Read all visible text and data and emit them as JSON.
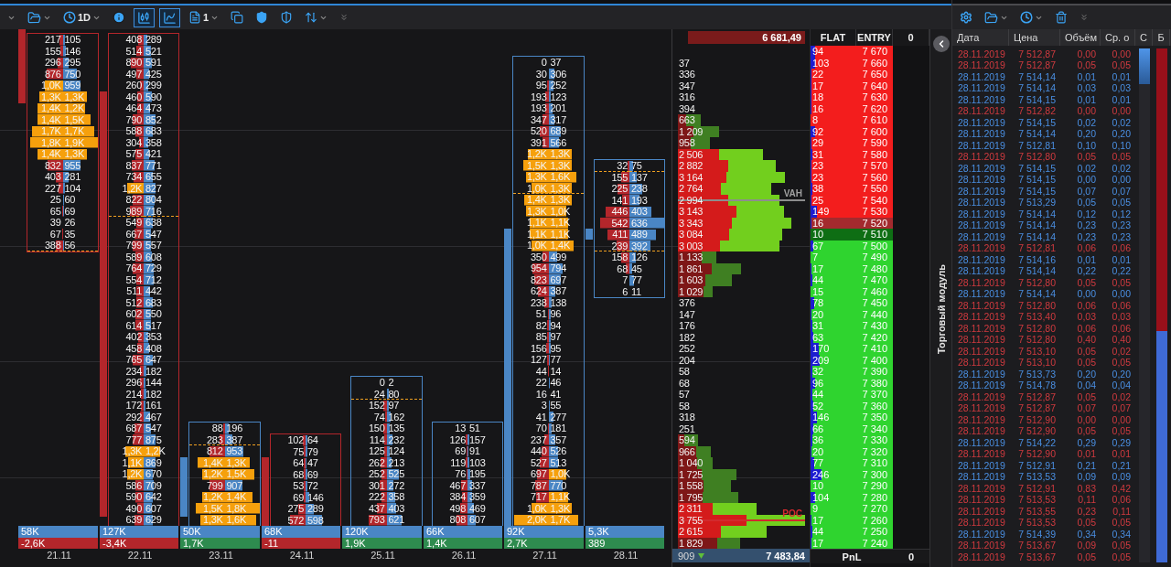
{
  "toolbar": {
    "timeframe": "1D",
    "layout_count": "1",
    "view_toggles": [
      {
        "selected": true
      },
      {
        "selected": true
      }
    ]
  },
  "columns": [
    {
      "date": "21.11",
      "kind": "down",
      "volume": "58K",
      "delta": "-2,6K",
      "blocks": [
        {
          "dashed": true,
          "rows": [
            {
              "bid": "217",
              "ask": "105"
            },
            {
              "bid": "155",
              "ask": "146"
            },
            {
              "bid": "296",
              "ask": "295"
            },
            {
              "bid": "876",
              "ask": "750"
            },
            {
              "bid": "1,0K",
              "ask": "959"
            },
            {
              "bid": "1,3K",
              "ask": "1,3K"
            },
            {
              "bid": "1,4K",
              "ask": "1,2K"
            },
            {
              "bid": "1,4K",
              "ask": "1,5K"
            },
            {
              "bid": "1,7K",
              "ask": "1,7K"
            },
            {
              "bid": "1,8K",
              "ask": "1,9K"
            },
            {
              "bid": "1,4K",
              "ask": "1,3K"
            },
            {
              "bid": "832",
              "ask": "955"
            },
            {
              "bid": "403",
              "ask": "281"
            },
            {
              "bid": "227",
              "ask": "104"
            },
            {
              "bid": "25",
              "ask": "60"
            },
            {
              "bid": "65",
              "ask": "69"
            },
            {
              "bid": "39",
              "ask": "26"
            },
            {
              "bid": "67",
              "ask": "35"
            },
            {
              "bid": "388",
              "ask": "56"
            }
          ]
        }
      ]
    },
    {
      "date": "22.11",
      "kind": "down",
      "volume": "127K",
      "delta": "-3,4K",
      "blocks": [
        {
          "dashed": true,
          "rows": [
            {
              "bid": "408",
              "ask": "289"
            },
            {
              "bid": "514",
              "ask": "521"
            },
            {
              "bid": "890",
              "ask": "591"
            },
            {
              "bid": "497",
              "ask": "425"
            },
            {
              "bid": "260",
              "ask": "299"
            },
            {
              "bid": "460",
              "ask": "590"
            },
            {
              "bid": "464",
              "ask": "473"
            },
            {
              "bid": "790",
              "ask": "852"
            },
            {
              "bid": "588",
              "ask": "683"
            },
            {
              "bid": "304",
              "ask": "358"
            },
            {
              "bid": "575",
              "ask": "421"
            },
            {
              "bid": "837",
              "ask": "771"
            },
            {
              "bid": "734",
              "ask": "655"
            },
            {
              "bid": "1,2K",
              "ask": "827"
            },
            {
              "bid": "822",
              "ask": "804"
            },
            {
              "bid": "989",
              "ask": "716"
            }
          ]
        },
        {
          "dashed": false,
          "rows": [
            {
              "bid": "549",
              "ask": "638"
            },
            {
              "bid": "667",
              "ask": "547"
            },
            {
              "bid": "799",
              "ask": "557"
            },
            {
              "bid": "589",
              "ask": "608"
            },
            {
              "bid": "764",
              "ask": "729"
            },
            {
              "bid": "554",
              "ask": "712"
            },
            {
              "bid": "511",
              "ask": "442"
            },
            {
              "bid": "512",
              "ask": "683"
            },
            {
              "bid": "602",
              "ask": "550"
            },
            {
              "bid": "614",
              "ask": "517"
            },
            {
              "bid": "402",
              "ask": "353"
            },
            {
              "bid": "458",
              "ask": "408"
            },
            {
              "bid": "765",
              "ask": "647"
            },
            {
              "bid": "234",
              "ask": "182"
            },
            {
              "bid": "296",
              "ask": "144"
            },
            {
              "bid": "214",
              "ask": "182"
            },
            {
              "bid": "172",
              "ask": "161"
            },
            {
              "bid": "292",
              "ask": "467"
            },
            {
              "bid": "687",
              "ask": "547"
            },
            {
              "bid": "777",
              "ask": "875"
            },
            {
              "bid": "1,3K",
              "ask": "1,2K"
            },
            {
              "bid": "1,1K",
              "ask": "869"
            },
            {
              "bid": "1,2K",
              "ask": "670"
            },
            {
              "bid": "586",
              "ask": "709"
            },
            {
              "bid": "590",
              "ask": "642"
            },
            {
              "bid": "490",
              "ask": "607"
            },
            {
              "bid": "639",
              "ask": "629"
            }
          ]
        }
      ]
    },
    {
      "date": "23.11",
      "kind": "up",
      "volume": "50K",
      "delta": "1,7K",
      "blocks": [
        {
          "dashed": true,
          "rows": [
            {
              "bid": "88",
              "ask": "196"
            },
            {
              "bid": "283",
              "ask": "387"
            }
          ]
        },
        {
          "dashed": false,
          "rows": [
            {
              "bid": "812",
              "ask": "953"
            },
            {
              "bid": "1,4K",
              "ask": "1,3K"
            },
            {
              "bid": "1,2K",
              "ask": "1,5K"
            },
            {
              "bid": "799",
              "ask": "907"
            },
            {
              "bid": "1,2K",
              "ask": "1,4K"
            },
            {
              "bid": "1,5K",
              "ask": "1,8K"
            },
            {
              "bid": "1,3K",
              "ask": "1,6K"
            }
          ]
        }
      ]
    },
    {
      "date": "24.11",
      "kind": "down",
      "volume": "68K",
      "delta": "-11",
      "blocks": [
        {
          "dashed": false,
          "rows": [
            {
              "bid": "102",
              "ask": "64"
            },
            {
              "bid": "75",
              "ask": "79"
            },
            {
              "bid": "64",
              "ask": "47"
            },
            {
              "bid": "68",
              "ask": "69"
            },
            {
              "bid": "53",
              "ask": "72"
            },
            {
              "bid": "69",
              "ask": "146"
            },
            {
              "bid": "275",
              "ask": "289"
            },
            {
              "bid": "572",
              "ask": "598"
            }
          ]
        }
      ]
    },
    {
      "date": "25.11",
      "kind": "up",
      "volume": "120K",
      "delta": "1,9K",
      "blocks": [
        {
          "dashed": true,
          "rows": [
            {
              "bid": "0",
              "ask": "2"
            },
            {
              "bid": "24",
              "ask": "80"
            }
          ]
        },
        {
          "dashed": false,
          "rows": [
            {
              "bid": "152",
              "ask": "97"
            },
            {
              "bid": "74",
              "ask": "162"
            },
            {
              "bid": "150",
              "ask": "135"
            },
            {
              "bid": "114",
              "ask": "232"
            },
            {
              "bid": "125",
              "ask": "124"
            },
            {
              "bid": "262",
              "ask": "213"
            },
            {
              "bid": "252",
              "ask": "525"
            },
            {
              "bid": "301",
              "ask": "272"
            },
            {
              "bid": "222",
              "ask": "358"
            },
            {
              "bid": "437",
              "ask": "403"
            },
            {
              "bid": "793",
              "ask": "621"
            }
          ]
        }
      ]
    },
    {
      "date": "26.11",
      "kind": "up",
      "volume": "66K",
      "delta": "1,4K",
      "blocks": [
        {
          "dashed": false,
          "rows": [
            {
              "bid": "13",
              "ask": "51"
            },
            {
              "bid": "126",
              "ask": "157"
            },
            {
              "bid": "69",
              "ask": "91"
            },
            {
              "bid": "119",
              "ask": "103"
            },
            {
              "bid": "76",
              "ask": "195"
            },
            {
              "bid": "467",
              "ask": "337"
            },
            {
              "bid": "384",
              "ask": "359"
            },
            {
              "bid": "498",
              "ask": "469"
            },
            {
              "bid": "808",
              "ask": "607"
            }
          ]
        }
      ]
    },
    {
      "date": "27.11",
      "kind": "up",
      "volume": "92K",
      "delta": "2,7K",
      "blocks": [
        {
          "dashed": true,
          "rows": [
            {
              "bid": "0",
              "ask": "37"
            },
            {
              "bid": "30",
              "ask": "306"
            },
            {
              "bid": "95",
              "ask": "252"
            },
            {
              "bid": "193",
              "ask": "123"
            },
            {
              "bid": "193",
              "ask": "201"
            },
            {
              "bid": "347",
              "ask": "317"
            },
            {
              "bid": "520",
              "ask": "689"
            },
            {
              "bid": "391",
              "ask": "566"
            },
            {
              "bid": "1,2K",
              "ask": "1,3K"
            },
            {
              "bid": "1,5K",
              "ask": "1,3K"
            },
            {
              "bid": "1,3K",
              "ask": "1,6K"
            },
            {
              "bid": "1,0K",
              "ask": "1,3K"
            }
          ]
        },
        {
          "dashed": false,
          "rows": [
            {
              "bid": "1,4K",
              "ask": "1,3K"
            },
            {
              "bid": "1,3K",
              "ask": "1,0K"
            },
            {
              "bid": "1,1K",
              "ask": "1,1K"
            },
            {
              "bid": "1,1K",
              "ask": "1,1K"
            },
            {
              "bid": "1,0K",
              "ask": "1,4K"
            },
            {
              "bid": "350",
              "ask": "499"
            },
            {
              "bid": "954",
              "ask": "794"
            },
            {
              "bid": "823",
              "ask": "697"
            },
            {
              "bid": "624",
              "ask": "387"
            },
            {
              "bid": "238",
              "ask": "138"
            },
            {
              "bid": "51",
              "ask": "96"
            },
            {
              "bid": "82",
              "ask": "94"
            },
            {
              "bid": "85",
              "ask": "97"
            },
            {
              "bid": "156",
              "ask": "95"
            },
            {
              "bid": "127",
              "ask": "77"
            },
            {
              "bid": "44",
              "ask": "14"
            },
            {
              "bid": "22",
              "ask": "46"
            },
            {
              "bid": "16",
              "ask": "41"
            },
            {
              "bid": "3",
              "ask": "55"
            },
            {
              "bid": "41",
              "ask": "277"
            },
            {
              "bid": "70",
              "ask": "181"
            },
            {
              "bid": "237",
              "ask": "357"
            },
            {
              "bid": "440",
              "ask": "526"
            },
            {
              "bid": "527",
              "ask": "513"
            },
            {
              "bid": "697",
              "ask": "1,0K"
            },
            {
              "bid": "787",
              "ask": "770"
            },
            {
              "bid": "717",
              "ask": "1,1K"
            },
            {
              "bid": "1,0K",
              "ask": "1,3K"
            },
            {
              "bid": "2,0K",
              "ask": "1,7K"
            }
          ]
        }
      ]
    },
    {
      "date": "28.11",
      "kind": "up",
      "volume": "5,3K",
      "delta": "389",
      "blocks": [
        {
          "dashed": true,
          "rows": [
            {
              "bid": "32",
              "ask": "75"
            }
          ]
        },
        {
          "dashed": true,
          "rows": [
            {
              "bid": "155",
              "ask": "137"
            },
            {
              "bid": "225",
              "ask": "238"
            },
            {
              "bid": "141",
              "ask": "193"
            },
            {
              "bid": "446",
              "ask": "403"
            },
            {
              "bid": "542",
              "ask": "636"
            },
            {
              "bid": "411",
              "ask": "489"
            },
            {
              "bid": "239",
              "ask": "392"
            }
          ]
        },
        {
          "dashed": false,
          "rows": [
            {
              "bid": "158",
              "ask": "126"
            },
            {
              "bid": "68",
              "ask": "45"
            },
            {
              "bid": "7",
              "ask": "77"
            },
            {
              "bid": "6",
              "ask": "11"
            }
          ]
        }
      ]
    }
  ],
  "profile": {
    "total": "6 681,49",
    "rows": [
      {
        "volume": "37"
      },
      {
        "volume": "336"
      },
      {
        "volume": "347"
      },
      {
        "volume": "316"
      },
      {
        "volume": "394"
      },
      {
        "volume": "663",
        "level": 0.38
      },
      {
        "volume": "1 209",
        "level": 0.38
      },
      {
        "volume": "958",
        "level": 0.4
      },
      {
        "volume": "2 506",
        "level": 0.48
      },
      {
        "volume": "2 882",
        "level": 0.52
      },
      {
        "volume": "3 164",
        "level": 0.45
      },
      {
        "volume": "2 764",
        "level": 0.46
      },
      {
        "volume": "2 994",
        "level": 0.5,
        "marker": {
          "kind": "vah",
          "label": "VAH"
        }
      },
      {
        "volume": "3 143",
        "level": 0.55
      },
      {
        "volume": "3 343",
        "level": 0.48
      },
      {
        "volume": "3 084",
        "level": 0.49
      },
      {
        "volume": "3 003",
        "level": 0.41
      },
      {
        "volume": "1 133",
        "level": 0.61
      },
      {
        "volume": "1 861",
        "level": 0.54
      },
      {
        "volume": "1 603",
        "level": 0.51
      },
      {
        "volume": "1 029",
        "level": 0.74
      },
      {
        "volume": "376"
      },
      {
        "volume": "147"
      },
      {
        "volume": "176"
      },
      {
        "volume": "182"
      },
      {
        "volume": "252"
      },
      {
        "volume": "204"
      },
      {
        "volume": "58"
      },
      {
        "volume": "68"
      },
      {
        "volume": "57"
      },
      {
        "volume": "58"
      },
      {
        "volume": "318"
      },
      {
        "volume": "251"
      },
      {
        "volume": "594",
        "level": 0.33
      },
      {
        "volume": "966",
        "level": 0.56
      },
      {
        "volume": "1 040",
        "level": 0.54
      },
      {
        "volume": "1 725",
        "level": 0.41
      },
      {
        "volume": "1 558",
        "level": 0.49
      },
      {
        "volume": "1 795",
        "level": 0.4
      },
      {
        "volume": "2 311",
        "level": 0.44
      },
      {
        "volume": "3 755",
        "level": 0.54,
        "marker": {
          "kind": "poc",
          "label": "POC"
        }
      },
      {
        "volume": "2 615",
        "level": 0.49
      },
      {
        "volume": "1 829",
        "level": 0.63
      }
    ],
    "footer": {
      "count": "909",
      "price": "7 483,84"
    }
  },
  "order_book": {
    "columns": [
      "FLAT",
      "ENTRY",
      "0"
    ],
    "rows": [
      {
        "size": "94",
        "price": "7 670",
        "kind": "ask"
      },
      {
        "size": "103",
        "price": "7 660",
        "kind": "ask"
      },
      {
        "size": "22",
        "price": "7 650",
        "kind": "ask"
      },
      {
        "size": "17",
        "price": "7 640",
        "kind": "ask"
      },
      {
        "size": "18",
        "price": "7 630",
        "kind": "ask"
      },
      {
        "size": "16",
        "price": "7 620",
        "kind": "ask"
      },
      {
        "size": "8",
        "price": "7 610",
        "kind": "ask"
      },
      {
        "size": "92",
        "price": "7 600",
        "kind": "ask"
      },
      {
        "size": "29",
        "price": "7 590",
        "kind": "ask"
      },
      {
        "size": "31",
        "price": "7 580",
        "kind": "ask"
      },
      {
        "size": "23",
        "price": "7 570",
        "kind": "ask"
      },
      {
        "size": "23",
        "price": "7 560",
        "kind": "ask"
      },
      {
        "size": "38",
        "price": "7 550",
        "kind": "ask"
      },
      {
        "size": "25",
        "price": "7 540",
        "kind": "ask"
      },
      {
        "size": "149",
        "price": "7 530",
        "kind": "ask"
      },
      {
        "size": "16",
        "price": "7 520",
        "kind": "best_ask"
      },
      {
        "size": "10",
        "price": "7 510",
        "kind": "best_bid"
      },
      {
        "size": "67",
        "price": "7 500",
        "kind": "bid"
      },
      {
        "size": "7",
        "price": "7 490",
        "kind": "bid"
      },
      {
        "size": "17",
        "price": "7 480",
        "kind": "bid"
      },
      {
        "size": "44",
        "price": "7 470",
        "kind": "bid"
      },
      {
        "size": "15",
        "price": "7 460",
        "kind": "bid"
      },
      {
        "size": "78",
        "price": "7 450",
        "kind": "bid"
      },
      {
        "size": "20",
        "price": "7 440",
        "kind": "bid"
      },
      {
        "size": "31",
        "price": "7 430",
        "kind": "bid"
      },
      {
        "size": "63",
        "price": "7 420",
        "kind": "bid"
      },
      {
        "size": "170",
        "price": "7 410",
        "kind": "bid"
      },
      {
        "size": "209",
        "price": "7 400",
        "kind": "bid"
      },
      {
        "size": "32",
        "price": "7 390",
        "kind": "bid"
      },
      {
        "size": "96",
        "price": "7 380",
        "kind": "bid"
      },
      {
        "size": "44",
        "price": "7 370",
        "kind": "bid"
      },
      {
        "size": "52",
        "price": "7 360",
        "kind": "bid"
      },
      {
        "size": "146",
        "price": "7 350",
        "kind": "bid"
      },
      {
        "size": "66",
        "price": "7 340",
        "kind": "bid"
      },
      {
        "size": "36",
        "price": "7 330",
        "kind": "bid"
      },
      {
        "size": "20",
        "price": "7 320",
        "kind": "bid"
      },
      {
        "size": "77",
        "price": "7 310",
        "kind": "bid"
      },
      {
        "size": "246",
        "price": "7 300",
        "kind": "bid"
      },
      {
        "size": "10",
        "price": "7 290",
        "kind": "bid"
      },
      {
        "size": "104",
        "price": "7 280",
        "kind": "bid"
      },
      {
        "size": "9",
        "price": "7 270",
        "kind": "bid"
      },
      {
        "size": "17",
        "price": "7 260",
        "kind": "bid"
      },
      {
        "size": "44",
        "price": "7 250",
        "kind": "bid"
      },
      {
        "size": "17",
        "price": "7 240",
        "kind": "bid"
      }
    ],
    "footer": {
      "label": "PnL",
      "value": "0"
    }
  },
  "side_panel": {
    "label": "Торговый модуль"
  },
  "trades": {
    "columns": [
      "Дата",
      "Цена",
      "Объём",
      "Ср. о",
      "С",
      "Б"
    ],
    "meters": [
      {
        "level": 0.07
      },
      {
        "level": 0.55
      }
    ],
    "rows": [
      {
        "date": "28.11.2019",
        "price": "7 512,87",
        "volume": "0,00",
        "avg": "0,00",
        "color": "#d03a3f"
      },
      {
        "date": "28.11.2019",
        "price": "7 512,87",
        "volume": "0,05",
        "avg": "0,05",
        "color": "#d03a3f"
      },
      {
        "date": "28.11.2019",
        "price": "7 514,14",
        "volume": "0,01",
        "avg": "0,01",
        "color": "#4a8fe2"
      },
      {
        "date": "28.11.2019",
        "price": "7 514,14",
        "volume": "0,03",
        "avg": "0,03",
        "color": "#4a8fe2"
      },
      {
        "date": "28.11.2019",
        "price": "7 514,15",
        "volume": "0,01",
        "avg": "0,01",
        "color": "#4a8fe2"
      },
      {
        "date": "28.11.2019",
        "price": "7 512,82",
        "volume": "0,00",
        "avg": "0,00",
        "color": "#d03a3f"
      },
      {
        "date": "28.11.2019",
        "price": "7 514,15",
        "volume": "0,02",
        "avg": "0,02",
        "color": "#4a8fe2"
      },
      {
        "date": "28.11.2019",
        "price": "7 514,14",
        "volume": "0,20",
        "avg": "0,20",
        "color": "#4a8fe2"
      },
      {
        "date": "28.11.2019",
        "price": "7 512,81",
        "volume": "0,10",
        "avg": "0,10",
        "color": "#4a8fe2"
      },
      {
        "date": "28.11.2019",
        "price": "7 512,80",
        "volume": "0,05",
        "avg": "0,05",
        "color": "#d03a3f"
      },
      {
        "date": "28.11.2019",
        "price": "7 514,15",
        "volume": "0,02",
        "avg": "0,02",
        "color": "#4a8fe2"
      },
      {
        "date": "28.11.2019",
        "price": "7 514,15",
        "volume": "0,00",
        "avg": "0,00",
        "color": "#4a8fe2"
      },
      {
        "date": "28.11.2019",
        "price": "7 514,15",
        "volume": "0,07",
        "avg": "0,07",
        "color": "#4a8fe2"
      },
      {
        "date": "28.11.2019",
        "price": "7 513,29",
        "volume": "0,05",
        "avg": "0,05",
        "color": "#4a8fe2"
      },
      {
        "date": "28.11.2019",
        "price": "7 514,14",
        "volume": "0,12",
        "avg": "0,12",
        "color": "#4a8fe2"
      },
      {
        "date": "28.11.2019",
        "price": "7 514,14",
        "volume": "0,23",
        "avg": "0,23",
        "color": "#4a8fe2"
      },
      {
        "date": "28.11.2019",
        "price": "7 514,14",
        "volume": "0,23",
        "avg": "0,23",
        "color": "#4a8fe2"
      },
      {
        "date": "28.11.2019",
        "price": "7 512,81",
        "volume": "0,06",
        "avg": "0,06",
        "color": "#d03a3f"
      },
      {
        "date": "28.11.2019",
        "price": "7 514,16",
        "volume": "0,01",
        "avg": "0,01",
        "color": "#4a8fe2"
      },
      {
        "date": "28.11.2019",
        "price": "7 514,14",
        "volume": "0,22",
        "avg": "0,22",
        "color": "#4a8fe2"
      },
      {
        "date": "28.11.2019",
        "price": "7 512,80",
        "volume": "0,05",
        "avg": "0,05",
        "color": "#d03a3f"
      },
      {
        "date": "28.11.2019",
        "price": "7 514,14",
        "volume": "0,00",
        "avg": "0,00",
        "color": "#4a8fe2"
      },
      {
        "date": "28.11.2019",
        "price": "7 512,80",
        "volume": "0,06",
        "avg": "0,06",
        "color": "#d03a3f"
      },
      {
        "date": "28.11.2019",
        "price": "7 513,40",
        "volume": "0,03",
        "avg": "0,03",
        "color": "#d03a3f"
      },
      {
        "date": "28.11.2019",
        "price": "7 512,80",
        "volume": "0,06",
        "avg": "0,06",
        "color": "#d03a3f"
      },
      {
        "date": "28.11.2019",
        "price": "7 512,80",
        "volume": "0,40",
        "avg": "0,40",
        "color": "#d03a3f"
      },
      {
        "date": "28.11.2019",
        "price": "7 513,10",
        "volume": "0,05",
        "avg": "0,02",
        "color": "#d03a3f"
      },
      {
        "date": "28.11.2019",
        "price": "7 513,10",
        "volume": "0,05",
        "avg": "0,05",
        "color": "#d03a3f"
      },
      {
        "date": "28.11.2019",
        "price": "7 513,73",
        "volume": "0,20",
        "avg": "0,20",
        "color": "#4a8fe2"
      },
      {
        "date": "28.11.2019",
        "price": "7 514,78",
        "volume": "0,04",
        "avg": "0,04",
        "color": "#4a8fe2"
      },
      {
        "date": "28.11.2019",
        "price": "7 512,87",
        "volume": "0,05",
        "avg": "0,02",
        "color": "#d03a3f"
      },
      {
        "date": "28.11.2019",
        "price": "7 512,87",
        "volume": "0,07",
        "avg": "0,07",
        "color": "#d03a3f"
      },
      {
        "date": "28.11.2019",
        "price": "7 512,90",
        "volume": "0,00",
        "avg": "0,00",
        "color": "#d03a3f"
      },
      {
        "date": "28.11.2019",
        "price": "7 512,90",
        "volume": "0,05",
        "avg": "0,05",
        "color": "#d03a3f"
      },
      {
        "date": "28.11.2019",
        "price": "7 514,22",
        "volume": "0,29",
        "avg": "0,29",
        "color": "#4a8fe2"
      },
      {
        "date": "28.11.2019",
        "price": "7 512,90",
        "volume": "0,01",
        "avg": "0,01",
        "color": "#d03a3f"
      },
      {
        "date": "28.11.2019",
        "price": "7 512,91",
        "volume": "0,21",
        "avg": "0,21",
        "color": "#4a8fe2"
      },
      {
        "date": "28.11.2019",
        "price": "7 513,53",
        "volume": "0,09",
        "avg": "0,09",
        "color": "#4a8fe2"
      },
      {
        "date": "28.11.2019",
        "price": "7 512,91",
        "volume": "0,83",
        "avg": "0,42",
        "color": "#d03a3f"
      },
      {
        "date": "28.11.2019",
        "price": "7 513,53",
        "volume": "0,11",
        "avg": "0,06",
        "color": "#d03a3f"
      },
      {
        "date": "28.11.2019",
        "price": "7 513,55",
        "volume": "0,23",
        "avg": "0,11",
        "color": "#d03a3f"
      },
      {
        "date": "28.11.2019",
        "price": "7 513,53",
        "volume": "0,05",
        "avg": "0,05",
        "color": "#d03a3f"
      },
      {
        "date": "28.11.2019",
        "price": "7 514,39",
        "volume": "0,34",
        "avg": "0,34",
        "color": "#4a8fe2"
      },
      {
        "date": "28.11.2019",
        "price": "7 513,67",
        "volume": "0,09",
        "avg": "0,05",
        "color": "#d03a3f"
      },
      {
        "date": "28.11.2019",
        "price": "7 513,67",
        "volume": "0,05",
        "avg": "0,05",
        "color": "#d03a3f"
      }
    ]
  }
}
